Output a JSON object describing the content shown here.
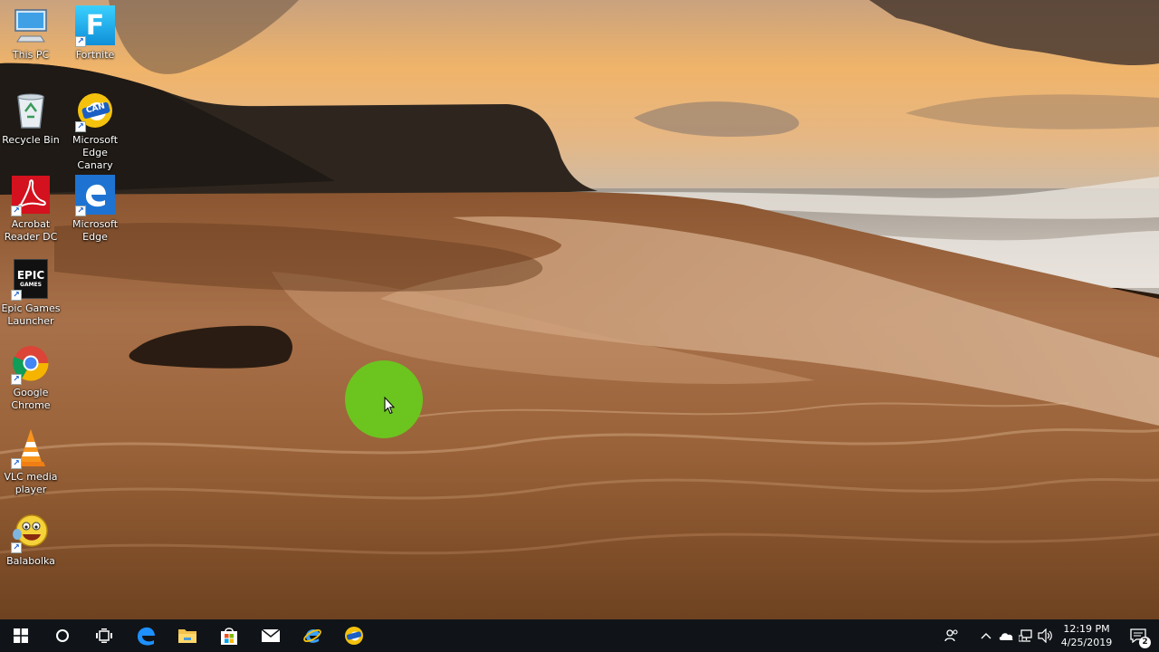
{
  "desktop": {
    "icons": [
      {
        "label": "This PC",
        "icon": "computer-icon"
      },
      {
        "label": "Fortnite",
        "icon": "fortnite-icon",
        "letter": "F"
      },
      {
        "label": "Recycle Bin",
        "icon": "recycle-bin-icon"
      },
      {
        "label": "Microsoft\nEdge Canary",
        "icon": "edge-canary-icon",
        "badge": "CAN"
      },
      {
        "label": "Acrobat\nReader DC",
        "icon": "acrobat-icon"
      },
      {
        "label": "Microsoft\nEdge",
        "icon": "edge-icon"
      },
      {
        "label": "Epic Games\nLauncher",
        "icon": "epic-games-icon",
        "logo_top": "EPIC",
        "logo_bottom": "GAMES"
      },
      {
        "label": "Google\nChrome",
        "icon": "chrome-icon"
      },
      {
        "label": "VLC media\nplayer",
        "icon": "vlc-icon"
      },
      {
        "label": "Balabolka",
        "icon": "balabolka-icon"
      }
    ]
  },
  "taskbar": {
    "pinned": [
      "start-icon",
      "cortana-icon",
      "task-view-icon",
      "edge-icon",
      "file-explorer-icon",
      "store-icon",
      "mail-icon",
      "internet-explorer-icon",
      "edge-canary-icon"
    ],
    "tray": [
      "people-icon",
      "chevron-up-icon",
      "onedrive-icon",
      "network-icon",
      "volume-icon"
    ],
    "clock": {
      "time": "12:19 PM",
      "date": "4/25/2019"
    },
    "notifications": {
      "count": "2"
    }
  },
  "colors": {
    "taskbar": "#101418",
    "cursor_highlight": "#6cc41f",
    "edge_blue": "#1e73d2"
  }
}
